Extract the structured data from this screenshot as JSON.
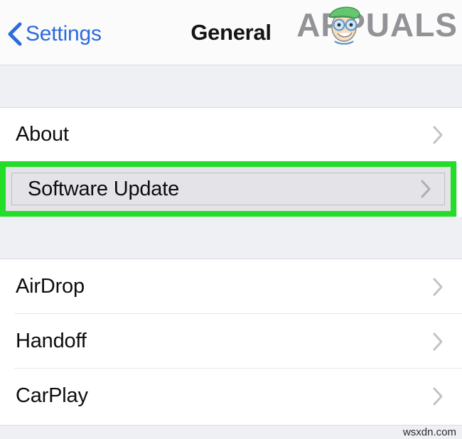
{
  "window": {
    "platform": "ios-settings",
    "background_color": "#ffffff",
    "group_background_color": "#eff0f3"
  },
  "navbar": {
    "back_label": "Settings",
    "back_icon": "chevron-left-icon",
    "back_color": "#2c6bdb",
    "title": "General"
  },
  "watermark": {
    "brand_text": "APPUALS",
    "brand_color": "#8e8e93",
    "face_icon": "cartoon-face-icon",
    "footer_text": "wsxdn.com"
  },
  "annotation": {
    "type": "highlight-box",
    "color": "#23dd29",
    "target_row": "Software Update"
  },
  "sections": [
    {
      "id": "about-section",
      "rows": [
        {
          "label": "About",
          "accessory": "chevron-right-icon",
          "highlighted": false
        }
      ]
    },
    {
      "id": "update-section",
      "rows": [
        {
          "label": "Software Update",
          "accessory": "chevron-right-icon",
          "highlighted": true
        }
      ]
    },
    {
      "id": "connectivity-section",
      "rows": [
        {
          "label": "AirDrop",
          "accessory": "chevron-right-icon",
          "highlighted": false
        },
        {
          "label": "Handoff",
          "accessory": "chevron-right-icon",
          "highlighted": false
        },
        {
          "label": "CarPlay",
          "accessory": "chevron-right-icon",
          "highlighted": false
        }
      ]
    }
  ]
}
